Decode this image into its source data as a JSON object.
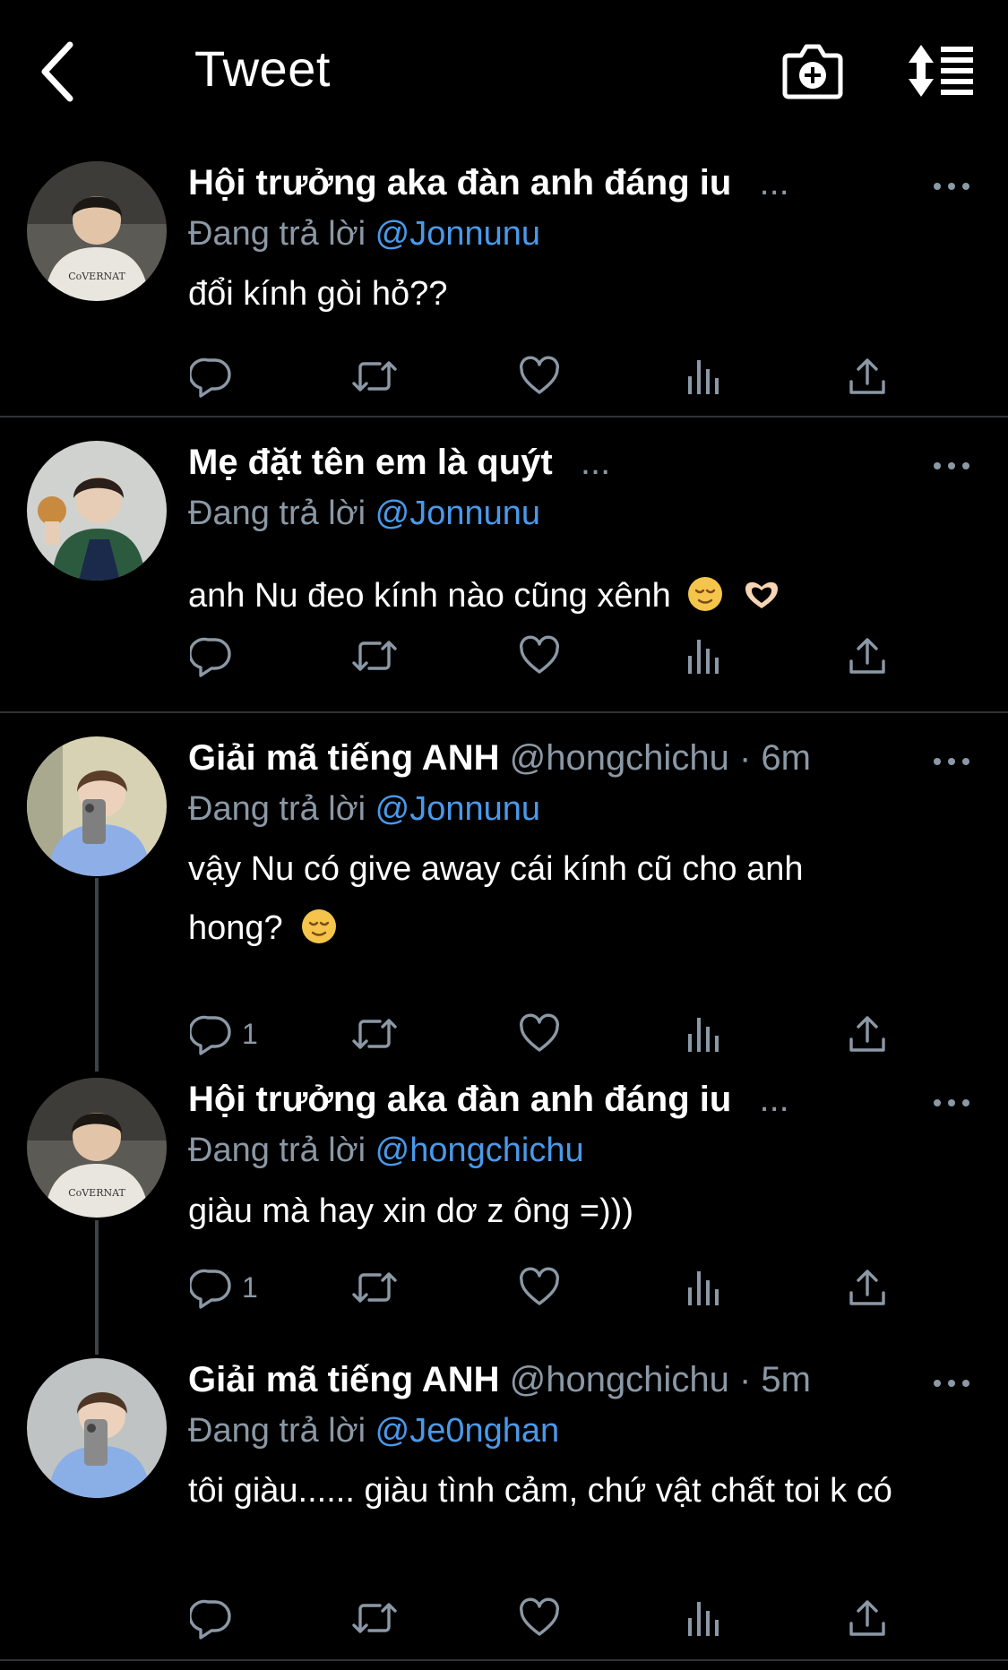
{
  "header": {
    "title": "Tweet"
  },
  "tweets": [
    {
      "name": "Hội trưởng aka đàn anh đáng iu",
      "handle": "",
      "time": "",
      "ellipsis": "...",
      "reply_prefix": "Đang trả lời",
      "reply_to": "@Jonnunu",
      "text": "đổi kính gòi hỏ??",
      "reply_count": ""
    },
    {
      "name": "Mẹ đặt tên em là quýt",
      "handle": "",
      "time": "",
      "ellipsis": "...",
      "reply_prefix": "Đang trả lời",
      "reply_to": "@Jonnunu",
      "text": "anh Nu đeo kính nào cũng xênh",
      "reply_count": ""
    },
    {
      "name": "Giải mã tiếng ANH",
      "handle": "@hongchichu",
      "time": "· 6m",
      "ellipsis": "",
      "reply_prefix": "Đang trả lời",
      "reply_to": "@Jonnunu",
      "text_line1": "vậy Nu có give away cái kính cũ cho anh",
      "text_line2": "hong?",
      "reply_count": "1"
    },
    {
      "name": "Hội trưởng aka đàn anh đáng iu",
      "handle": "",
      "time": "",
      "ellipsis": "...",
      "reply_prefix": "Đang trả lời",
      "reply_to": "@hongchichu",
      "text": "giàu mà hay xin dơ z ông =)))",
      "reply_count": "1"
    },
    {
      "name": "Giải mã tiếng ANH",
      "handle": "@hongchichu",
      "time": "· 5m",
      "ellipsis": "",
      "reply_prefix": "Đang trả lời",
      "reply_to": "@Je0nghan",
      "text": "tôi giàu...... giàu tình cảm, chứ vật chất toi k có",
      "reply_count": ""
    }
  ],
  "icons": [
    "back-arrow-icon",
    "camera-plus-icon",
    "sort-icon",
    "more-icon",
    "reply-icon",
    "retweet-icon",
    "like-icon",
    "views-icon",
    "share-icon"
  ],
  "colors": {
    "background": "#000000",
    "text": "#ffffff",
    "muted": "#8b98a5",
    "link": "#4a99e9",
    "divider": "#2f3336"
  }
}
